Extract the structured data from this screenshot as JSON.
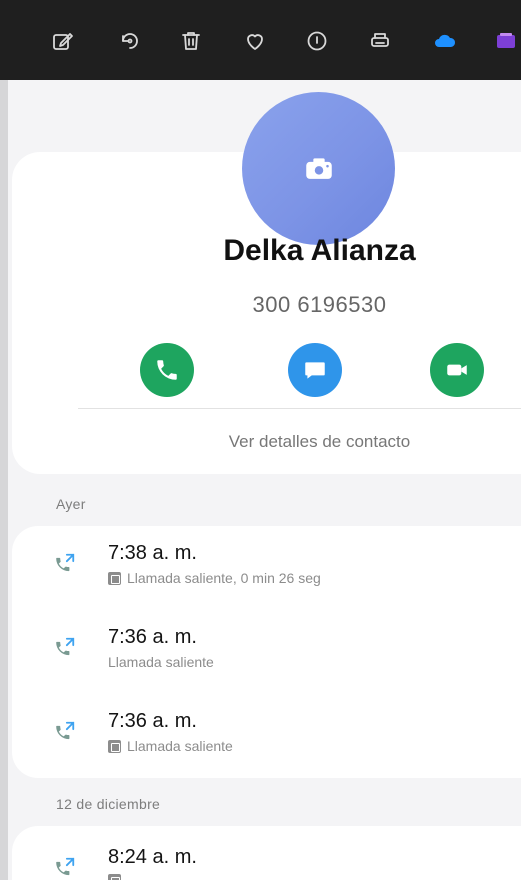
{
  "toolbar": {
    "icons": [
      "edit-icon",
      "rotate-icon",
      "trash-icon",
      "heart-icon",
      "info-icon",
      "print-icon",
      "cloud-icon",
      "photo-icon"
    ]
  },
  "contact": {
    "name": "Delka Alianza",
    "number": "300 6196530",
    "details_link": "Ver detalles de contacto",
    "actions": [
      "call",
      "message",
      "video"
    ]
  },
  "colors": {
    "toolbar_bg": "#1f1f1f",
    "avatar": "#7d94e6",
    "call_green": "#1ea55f",
    "message_blue": "#2f95ea",
    "cloud_blue": "#1e90ff",
    "outgoing_call_icon": "#7a9a92"
  },
  "call_log": {
    "groups": [
      {
        "label": "Ayer",
        "calls": [
          {
            "time": "7:38 a. m.",
            "detail": "Llamada saliente, 0 min 26 seg",
            "sim_icon": true
          },
          {
            "time": "7:36 a. m.",
            "detail": "Llamada saliente",
            "sim_icon": false
          },
          {
            "time": "7:36 a. m.",
            "detail": "Llamada saliente",
            "sim_icon": true
          }
        ]
      },
      {
        "label": "12 de diciembre",
        "calls": [
          {
            "time": "8:24 a. m.",
            "detail": "",
            "sim_icon": true
          }
        ]
      }
    ]
  }
}
